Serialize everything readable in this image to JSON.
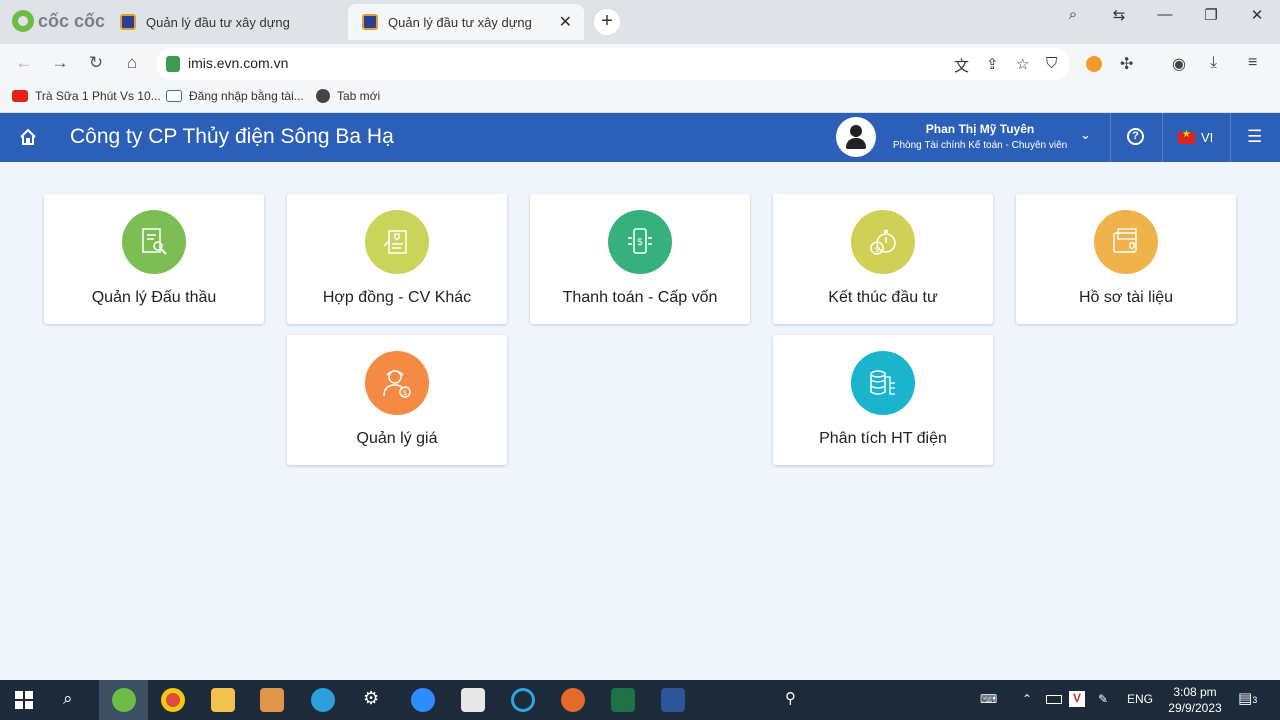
{
  "browser": {
    "brand": "cốc cốc",
    "tabs": [
      {
        "title": "Quản lý đầu tư xây dựng",
        "active": false
      },
      {
        "title": "Quản lý đầu tư xây dựng",
        "active": true
      }
    ],
    "new_tab": "+",
    "url": "imis.evn.com.vn",
    "bookmarks": [
      {
        "label": "Trà Sữa 1 Phút Vs 10...",
        "icon": "youtube-icon"
      },
      {
        "label": "Đăng nhập bằng tài...",
        "icon": "zalo-icon"
      },
      {
        "label": "Tab mới",
        "icon": "globe-icon"
      }
    ]
  },
  "app": {
    "company": "Công ty CP Thủy điện Sông Ba Hạ",
    "user_name": "Phan Thị Mỹ Tuyên",
    "user_role": "Phòng Tài chính Kế toán - Chuyên viên",
    "help": "?",
    "language": "VI",
    "modules": [
      {
        "label": "Quản lý Đấu thầu",
        "color": "#7cbd54",
        "icon": "bidding-document-icon"
      },
      {
        "label": "Hợp đồng - CV Khác",
        "color": "#c8d45a",
        "icon": "contract-icon"
      },
      {
        "label": "Thanh toán - Cấp vốn",
        "color": "#36b07c",
        "icon": "mobile-payment-icon"
      },
      {
        "label": "Kết thúc đầu tư",
        "color": "#cfd055",
        "icon": "money-stopwatch-icon"
      },
      {
        "label": "Hồ sơ tài liệu",
        "color": "#f0b24a",
        "icon": "document-folder-icon"
      },
      {
        "label": "Quản lý giá",
        "color": "#f58a44",
        "icon": "price-manager-icon"
      },
      {
        "label": "Phân tích HT điện",
        "color": "#1ab5cc",
        "icon": "database-analysis-icon"
      }
    ]
  },
  "taskbar": {
    "language": "ENG",
    "time": "3:08 pm",
    "date": "29/9/2023",
    "notifications": "3"
  }
}
